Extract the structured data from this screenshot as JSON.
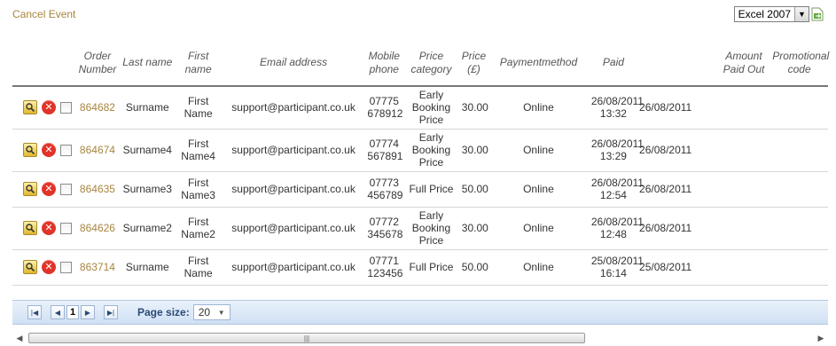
{
  "header": {
    "cancel_label": "Cancel Event",
    "export_format": "Excel 2007"
  },
  "columns": [
    "",
    "Order Number",
    "Last name",
    "First name",
    "Email address",
    "Mobile phone",
    "Price category",
    "Price (£)",
    "Paymentmethod",
    "Paid",
    "",
    "Amount Paid Out",
    "Promotional code"
  ],
  "rows": [
    {
      "order": "864682",
      "last": "Surname",
      "first": "First Name",
      "email": "support@participant.co.uk",
      "mobile": "07775 678912",
      "category": "Early Booking Price",
      "price": "30.00",
      "method": "Online",
      "paid": "26/08/2011 13:32",
      "paid_date": "26/08/2011",
      "amount_out": "",
      "promo": ""
    },
    {
      "order": "864674",
      "last": "Surname4",
      "first": "First Name4",
      "email": "support@participant.co.uk",
      "mobile": "07774 567891",
      "category": "Early Booking Price",
      "price": "30.00",
      "method": "Online",
      "paid": "26/08/2011 13:29",
      "paid_date": "26/08/2011",
      "amount_out": "",
      "promo": ""
    },
    {
      "order": "864635",
      "last": "Surname3",
      "first": "First Name3",
      "email": "support@participant.co.uk",
      "mobile": "07773 456789",
      "category": "Full Price",
      "price": "50.00",
      "method": "Online",
      "paid": "26/08/2011 12:54",
      "paid_date": "26/08/2011",
      "amount_out": "",
      "promo": ""
    },
    {
      "order": "864626",
      "last": "Surname2",
      "first": "First Name2",
      "email": "support@participant.co.uk",
      "mobile": "07772 345678",
      "category": "Early Booking Price",
      "price": "30.00",
      "method": "Online",
      "paid": "26/08/2011 12:48",
      "paid_date": "26/08/2011",
      "amount_out": "",
      "promo": ""
    },
    {
      "order": "863714",
      "last": "Surname",
      "first": "First Name",
      "email": "support@participant.co.uk",
      "mobile": "07771 123456",
      "category": "Full Price",
      "price": "50.00",
      "method": "Online",
      "paid": "25/08/2011 16:14",
      "paid_date": "25/08/2011",
      "amount_out": "",
      "promo": ""
    }
  ],
  "pager": {
    "current_page": "1",
    "page_size_label": "Page size:",
    "page_size": "20"
  },
  "icons": {
    "view": "magnifier-icon",
    "delete": "delete-icon",
    "export": "export-icon"
  },
  "colors": {
    "link": "#a8853f",
    "pager_bg": "#cfe0f4",
    "delete": "#e0332a"
  }
}
